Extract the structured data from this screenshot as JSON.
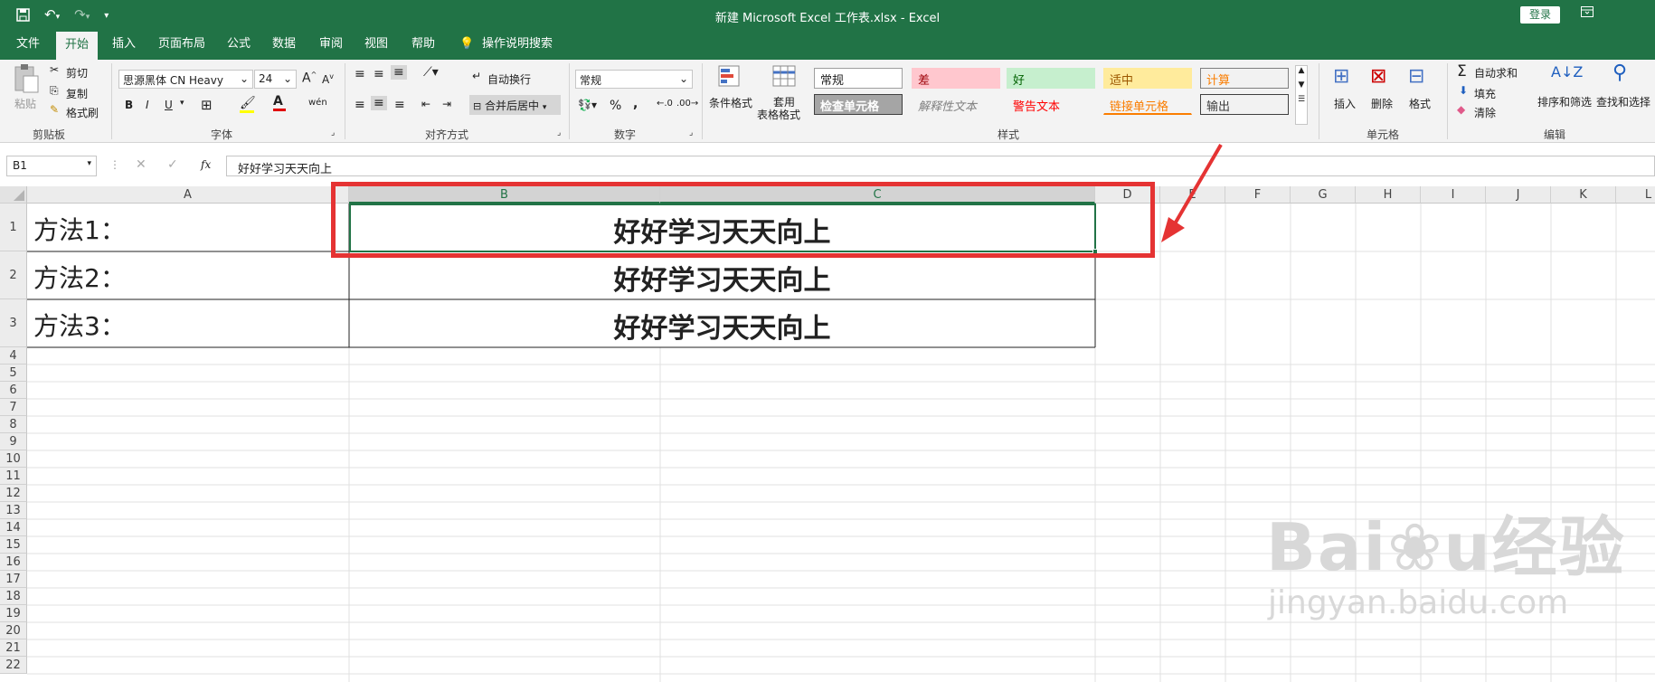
{
  "window": {
    "title": "新建 Microsoft Excel 工作表.xlsx  -  Excel",
    "login_label": "登录"
  },
  "tabs": [
    "文件",
    "开始",
    "插入",
    "页面布局",
    "公式",
    "数据",
    "审阅",
    "视图",
    "帮助",
    "操作说明搜索"
  ],
  "active_tab": "开始",
  "ribbon": {
    "clipboard": {
      "paste": "粘贴",
      "cut": "剪切",
      "copy": "复制",
      "format_painter": "格式刷",
      "label": "剪贴板"
    },
    "font": {
      "name": "思源黑体 CN Heavy",
      "size": "24",
      "label": "字体",
      "bold": "B",
      "italic": "I",
      "underline": "U"
    },
    "alignment": {
      "wrap": "自动换行",
      "merge": "合并后居中",
      "label": "对齐方式"
    },
    "number": {
      "format": "常规",
      "percent": "%",
      "comma": ",",
      "label": "数字"
    },
    "styles": {
      "cond_format": "条件格式",
      "table_format_1": "套用",
      "table_format_2": "表格格式",
      "label": "样式",
      "cells": [
        {
          "text": "常规",
          "bg": "#ffffff",
          "color": "#222222",
          "border": "#9e9e9e"
        },
        {
          "text": "差",
          "bg": "#ffc7ce",
          "color": "#9c0006",
          "border": "#ffc7ce"
        },
        {
          "text": "好",
          "bg": "#c6efce",
          "color": "#006100",
          "border": "#c6efce"
        },
        {
          "text": "适中",
          "bg": "#ffeb9c",
          "color": "#9c5700",
          "border": "#ffeb9c"
        },
        {
          "text": "计算",
          "bg": "#f2f2f2",
          "color": "#fa7d00",
          "border": "#7f7f7f"
        },
        {
          "text": "检查单元格",
          "bg": "#a5a5a5",
          "color": "#ffffff",
          "border": "#3f3f3f"
        },
        {
          "text": "解释性文本",
          "bg": "#f3f3f3",
          "color": "#7f7f7f",
          "border": "#f3f3f3"
        },
        {
          "text": "警告文本",
          "bg": "#f3f3f3",
          "color": "#ff0000",
          "border": "#f3f3f3"
        },
        {
          "text": "链接单元格",
          "bg": "#f3f3f3",
          "color": "#fa7d00",
          "border": "#f3f3f3"
        },
        {
          "text": "输出",
          "bg": "#f2f2f2",
          "color": "#3f3f3f",
          "border": "#3f3f3f"
        }
      ]
    },
    "cells_group": {
      "insert": "插入",
      "delete": "删除",
      "format": "格式",
      "label": "单元格"
    },
    "editing": {
      "autosum": "自动求和",
      "fill": "填充",
      "clear": "清除",
      "sort_filter": "排序和筛选",
      "find_select": "查找和选择",
      "label": "编辑"
    }
  },
  "formula_bar": {
    "name_box": "B1",
    "fx": "fx",
    "content": "好好学习天天向上"
  },
  "columns": [
    "A",
    "B",
    "C",
    "D",
    "E",
    "F",
    "G",
    "H",
    "I",
    "J",
    "K",
    "L"
  ],
  "rows": [
    "1",
    "2",
    "3",
    "4",
    "5",
    "6",
    "7",
    "8",
    "9",
    "10",
    "11",
    "12",
    "13",
    "14",
    "15",
    "16",
    "17",
    "18",
    "19",
    "20",
    "21",
    "22"
  ],
  "sheet": {
    "A1": "方法1：",
    "A2": "方法2：",
    "A3": "方法3：",
    "B1": "好好学习天天向上",
    "B2": "好好学习天天向上",
    "B3": "好好学习天天向上"
  },
  "watermark": "Baidu经验 jingyan.baidu.com",
  "colors": {
    "excel_green": "#217346",
    "highlight_red": "#e53333"
  }
}
